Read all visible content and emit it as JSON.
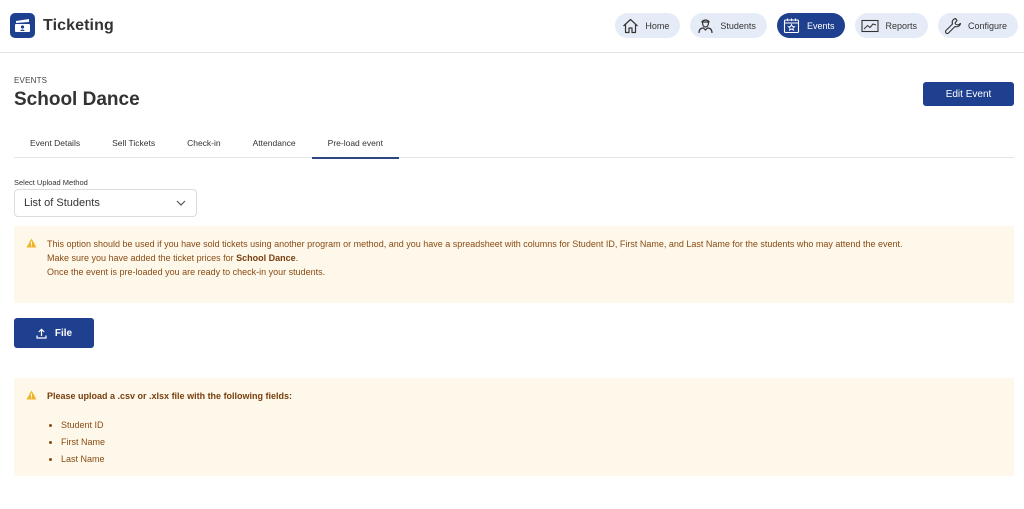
{
  "app": {
    "title": "Ticketing",
    "logo_icon": "ticket-building-icon"
  },
  "nav": [
    {
      "label": "Home",
      "icon": "home-icon",
      "active": false
    },
    {
      "label": "Students",
      "icon": "student-icon",
      "active": false
    },
    {
      "label": "Events",
      "icon": "calendar-star-icon",
      "active": true
    },
    {
      "label": "Reports",
      "icon": "chart-line-icon",
      "active": false
    },
    {
      "label": "Configure",
      "icon": "wrench-icon",
      "active": false
    }
  ],
  "page": {
    "eyebrow": "EVENTS",
    "title": "School Dance",
    "edit_button": "Edit Event"
  },
  "tabs": [
    {
      "label": "Event Details",
      "active": false
    },
    {
      "label": "Sell Tickets",
      "active": false
    },
    {
      "label": "Check-in",
      "active": false
    },
    {
      "label": "Attendance",
      "active": false
    },
    {
      "label": "Pre-load event",
      "active": true
    }
  ],
  "upload_method": {
    "label": "Select Upload Method",
    "selected": "List of Students"
  },
  "info_alert": {
    "line1": "This option should be used if you have sold tickets using another program or method, and you have a spreadsheet with columns for Student ID, First Name, and Last Name for the students who may attend the event.",
    "line2_prefix": "Make sure you have added the ticket prices for ",
    "line2_event": "School Dance",
    "line2_suffix": ".",
    "line3": "Once the event is pre-loaded you are ready to check-in your students."
  },
  "file_button": "File",
  "fields_alert": {
    "heading": "Please upload a .csv or .xlsx file with the following fields:",
    "fields": [
      "Student ID",
      "First Name",
      "Last Name"
    ]
  },
  "colors": {
    "primary": "#1f3f8f",
    "nav_inactive_bg": "#e6ecf7",
    "alert_bg": "#fdf8e9",
    "alert_text": "#8a4a14",
    "warning_icon": "#f0b429"
  }
}
